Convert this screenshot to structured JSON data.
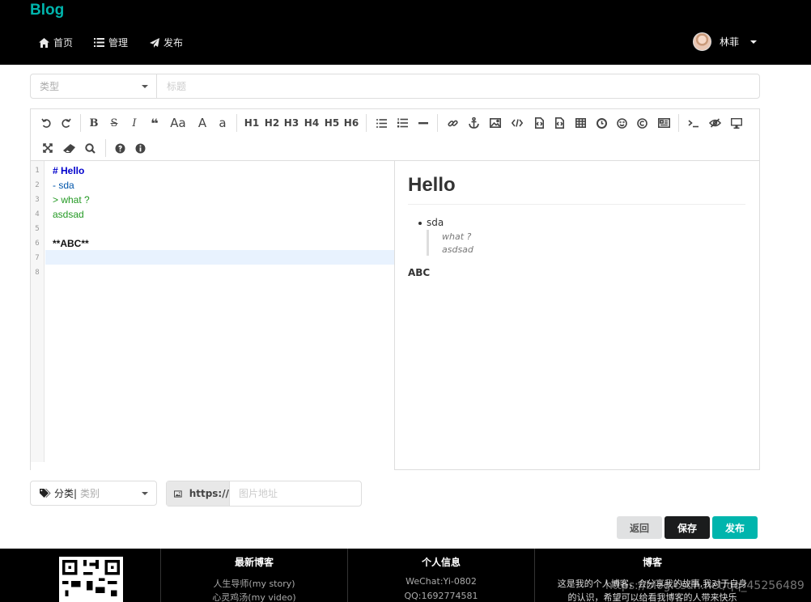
{
  "header": {
    "brand": "Blog",
    "nav": [
      {
        "icon": "home-icon",
        "label": "首页"
      },
      {
        "icon": "list-icon",
        "label": "管理"
      },
      {
        "icon": "send-icon",
        "label": "发布"
      }
    ],
    "user": {
      "name": "林菲"
    }
  },
  "form": {
    "type_placeholder": "类型",
    "title_placeholder": "标题",
    "category_label": "分类|",
    "category_placeholder": "类别",
    "image_prefix": "https://",
    "image_placeholder": "图片地址"
  },
  "toolbar": {
    "headings": [
      "H1",
      "H2",
      "H3",
      "H4",
      "H5",
      "H6"
    ],
    "text_tools": [
      "B",
      "S",
      "I",
      "❝",
      "Aa",
      "A",
      "a"
    ]
  },
  "editor": {
    "lines": [
      "1",
      "2",
      "3",
      "4",
      "5",
      "6",
      "7",
      "8"
    ],
    "code": {
      "l1": "# Hello",
      "l2": "- sda",
      "l3": "> what ?",
      "l4": "asdsad",
      "l6": "**ABC**"
    }
  },
  "preview": {
    "h1": "Hello",
    "bullet": "sda",
    "quote1": "what ?",
    "quote2": "asdsad",
    "strong": "ABC"
  },
  "buttons": {
    "back": "返回",
    "save": "保存",
    "publish": "发布"
  },
  "footer": {
    "col1": {
      "title": "最新博客",
      "items": [
        "人生导师(my story)",
        "心灵鸡汤(my video)"
      ]
    },
    "col2": {
      "title": "个人信息",
      "items": [
        "WeChat:Yi-0802",
        "QQ:1692774581"
      ]
    },
    "col3": {
      "title": "博客",
      "text1": "这是我的个人博客，会分享我的故事,我对于自身",
      "text2": "的认识，希望可以给看我博客的人带来快乐"
    },
    "watermark": "https://blog.csdn.net/qq_45256489"
  },
  "colors": {
    "accent": "#00b5ad",
    "dark": "#1b1c1d",
    "header_bg": "#000000"
  }
}
